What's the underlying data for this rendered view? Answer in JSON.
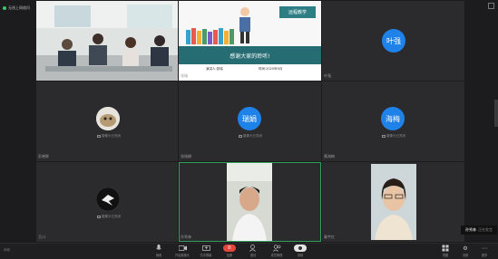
{
  "topbar": {
    "network_label": "无线上网络问"
  },
  "slide": {
    "badge": "远程教学",
    "thanks": "感谢大家的聆听!",
    "speaker": "演讲人:张瑞",
    "date": "时间:2020年9月"
  },
  "tiles": [
    {
      "name": "",
      "type": "video-group"
    },
    {
      "name": "张瑞",
      "type": "slide"
    },
    {
      "name": "叶强",
      "avatar": "叶强",
      "type": "avatar"
    },
    {
      "name": "彭晓辉",
      "camera_off": "摄像头已关闭",
      "type": "photo-avatar"
    },
    {
      "name": "张瑞娟",
      "avatar": "瑞娟",
      "camera_off": "摄像头已关闭",
      "type": "avatar"
    },
    {
      "name": "黄海梅",
      "avatar": "海梅",
      "camera_off": "摄像头已关闭",
      "type": "avatar"
    },
    {
      "name": "王川",
      "camera_off": "摄像头已关闭",
      "type": "photo-avatar"
    },
    {
      "name": "孙秀林",
      "type": "video"
    },
    {
      "name": "秦宇红",
      "type": "video"
    }
  ],
  "speaker_tag": {
    "name": "孙秀林",
    "status": "正在发言"
  },
  "toolbar": {
    "network": "网络",
    "items": [
      {
        "label": "静音",
        "icon": "mic-icon"
      },
      {
        "label": "开启摄像头",
        "icon": "camera-icon"
      },
      {
        "label": "共享屏幕",
        "icon": "screen-share-icon"
      },
      {
        "label": "挂断",
        "icon": "hangup-icon"
      },
      {
        "label": "邀请",
        "icon": "invite-icon"
      },
      {
        "label": "成员管理",
        "icon": "members-icon"
      },
      {
        "label": "录制",
        "icon": "record-icon"
      },
      {
        "label": "视图",
        "icon": "grid-view-icon"
      },
      {
        "label": "设置",
        "icon": "settings-icon"
      },
      {
        "label": "更多",
        "icon": "more-icon"
      }
    ]
  }
}
